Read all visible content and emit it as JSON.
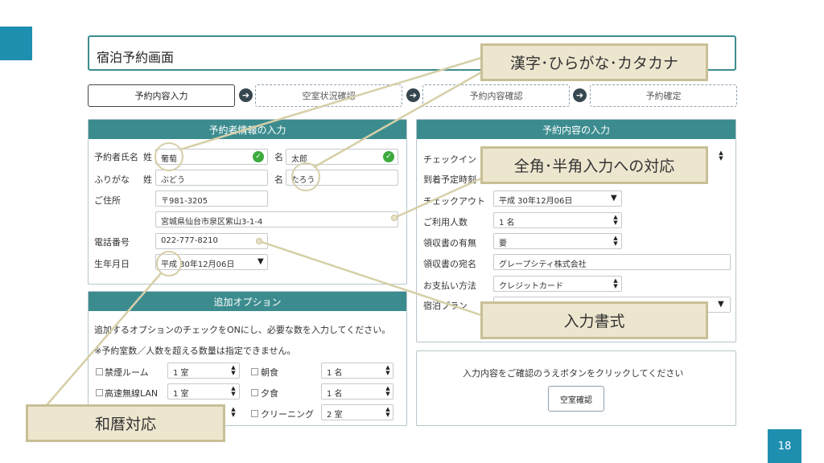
{
  "page_title": "宿泊予約画面",
  "page_number": "18",
  "steps": [
    "予約内容入力",
    "空室状況確認",
    "予約内容確認",
    "予約確定"
  ],
  "booker": {
    "header": "予約者情報の入力",
    "name_label": "予約者氏名",
    "sei_label": "姓",
    "mei_label": "名",
    "sei_value": "葡萄",
    "mei_value": "太郎",
    "kana_label": "ふりがな",
    "kana_sei_value": "ぶどう",
    "kana_mei_value": "たろう",
    "address_label": "ご住所",
    "postal_value": "〒981-3205",
    "address_value": "宮城県仙台市泉区紫山3-1-4",
    "phone_label": "電話番号",
    "phone_value": "022-777-8210",
    "birth_label": "生年月日",
    "birth_value": "平成 30年12月06日"
  },
  "options": {
    "header": "追加オプション",
    "note1": "追加するオプションのチェックをONにし、必要な数を入力してください。",
    "note2": "※予約室数／人数を超える数量は指定できません。",
    "items": [
      {
        "label": "禁煙ルーム",
        "value": "1 室"
      },
      {
        "label": "朝食",
        "value": "1 名"
      },
      {
        "label": "高速無線LAN",
        "value": "1 室"
      },
      {
        "label": "夕食",
        "value": "1 名"
      },
      {
        "label": "",
        "value": ""
      },
      {
        "label": "クリーニング",
        "value": "2 室"
      }
    ]
  },
  "reservation": {
    "header": "予約内容の入力",
    "checkin_label": "チェックイン",
    "arrival_label": "到着予定時刻",
    "checkout_label": "チェックアウト",
    "checkout_value": "平成 30年12月06日",
    "guests_label": "ご利用人数",
    "guests_value": "1 名",
    "receipt_label": "領収書の有無",
    "receipt_value": "要",
    "receipt_name_label": "領収書の宛名",
    "receipt_name_value": "グレープシティ株式会社",
    "payment_label": "お支払い方法",
    "payment_value": "クレジットカード",
    "plan_label": "宿泊プラン"
  },
  "confirm": {
    "message": "入力内容をご確認のうえボタンをクリックしてください",
    "button": "空室確認"
  },
  "callouts": {
    "kanji": "漢字･ひらがな･カタカナ",
    "zenkaku": "全角･半角入力への対応",
    "format": "入力書式",
    "wareki": "和暦対応"
  },
  "icons": {
    "arrow": "arrow-right-circle-icon",
    "check": "check-circle-icon",
    "spinner": "spinner-icon",
    "dropdown": "dropdown-triangle-icon"
  },
  "colors": {
    "accent": "#1f8fb0",
    "panel_header": "#3c8c8f",
    "callout_bg": "#ede6cf",
    "callout_border": "#c8bf96",
    "valid": "#3daa3d"
  }
}
